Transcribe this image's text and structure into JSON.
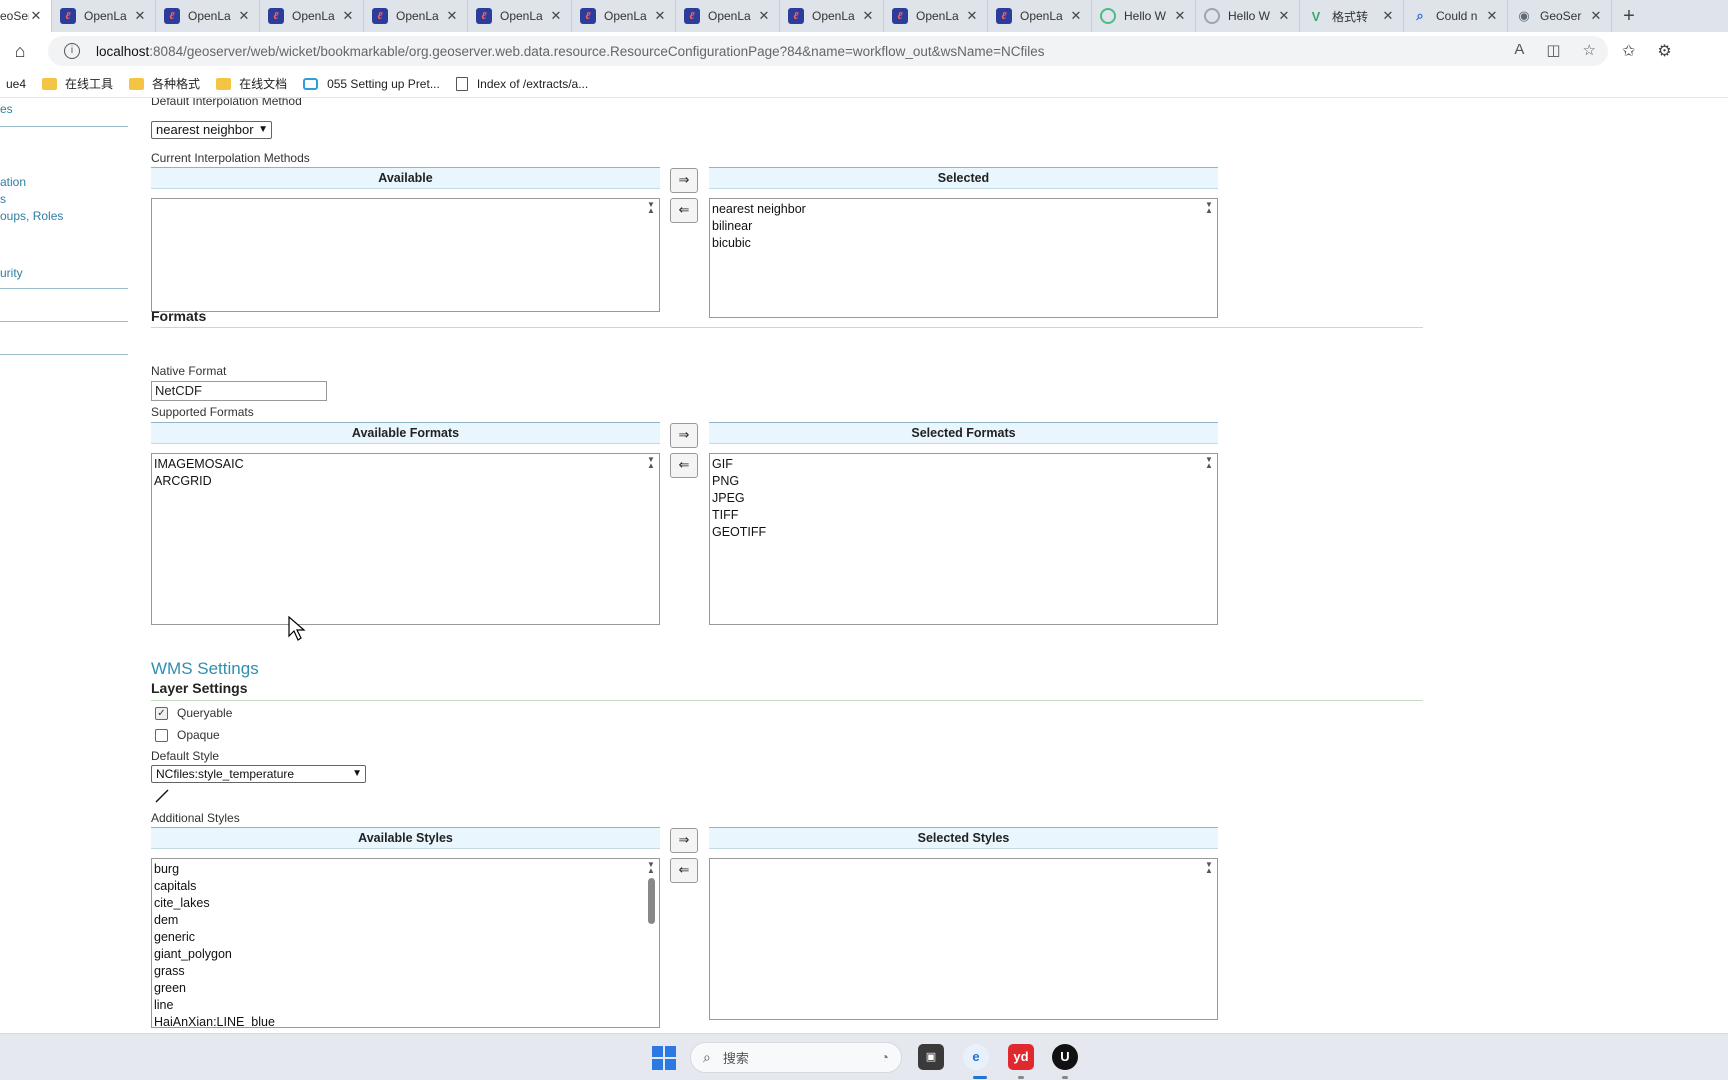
{
  "browser": {
    "tabs": [
      {
        "label": "eoSer",
        "icon": "geoserver-icon",
        "active": true
      },
      {
        "label": "OpenLa",
        "icon": "openlayers-icon"
      },
      {
        "label": "OpenLa",
        "icon": "openlayers-icon"
      },
      {
        "label": "OpenLa",
        "icon": "openlayers-icon"
      },
      {
        "label": "OpenLa",
        "icon": "openlayers-icon"
      },
      {
        "label": "OpenLa",
        "icon": "openlayers-icon"
      },
      {
        "label": "OpenLa",
        "icon": "openlayers-icon"
      },
      {
        "label": "OpenLa",
        "icon": "openlayers-icon"
      },
      {
        "label": "OpenLa",
        "icon": "openlayers-icon"
      },
      {
        "label": "OpenLa",
        "icon": "openlayers-icon"
      },
      {
        "label": "OpenLa",
        "icon": "openlayers-icon"
      },
      {
        "label": "Hello W",
        "icon": "hello-icon"
      },
      {
        "label": "Hello W",
        "icon": "hello-icon"
      },
      {
        "label": "格式转",
        "icon": "vue-icon"
      },
      {
        "label": "Could n",
        "icon": "search-icon"
      },
      {
        "label": "GeoSer",
        "icon": "geoserver-icon"
      }
    ],
    "url_host": "localhost",
    "url_rest": ":8084/geoserver/web/wicket/bookmarkable/org.geoserver.web.data.resource.ResourceConfigurationPage?84&name=workflow_out&wsName=NCfiles",
    "bookmarks": [
      {
        "label": "ue4",
        "icon": "none"
      },
      {
        "label": "在线工具",
        "icon": "folder-icon"
      },
      {
        "label": "各种格式",
        "icon": "folder-icon"
      },
      {
        "label": "在线文档",
        "icon": "folder-icon"
      },
      {
        "label": "055 Setting up Pret...",
        "icon": "tv-icon"
      },
      {
        "label": "Index of /extracts/a...",
        "icon": "page-icon"
      }
    ]
  },
  "sidebar": {
    "links": [
      "es",
      "ation",
      "s",
      "oups, Roles",
      "urity"
    ]
  },
  "interpolation": {
    "default_label": "Default Interpolation Method",
    "default_value": "nearest neighbor",
    "current_label": "Current Interpolation Methods",
    "available_header": "Available",
    "selected_header": "Selected",
    "available": [],
    "selected": [
      "nearest neighbor",
      "bilinear",
      "bicubic"
    ]
  },
  "formats": {
    "title": "Formats",
    "native_label": "Native Format",
    "native_value": "NetCDF",
    "supported_label": "Supported Formats",
    "available_header": "Available Formats",
    "selected_header": "Selected Formats",
    "available": [
      "IMAGEMOSAIC",
      "ARCGRID"
    ],
    "selected": [
      "GIF",
      "PNG",
      "JPEG",
      "TIFF",
      "GEOTIFF"
    ]
  },
  "wms": {
    "title": "WMS Settings",
    "layer_settings": "Layer Settings",
    "queryable_label": "Queryable",
    "queryable": true,
    "opaque_label": "Opaque",
    "opaque": false,
    "default_style_label": "Default Style",
    "default_style": "NCfiles:style_temperature",
    "additional_styles_label": "Additional Styles",
    "available_header": "Available Styles",
    "selected_header": "Selected Styles",
    "available": [
      "burg",
      "capitals",
      "cite_lakes",
      "dem",
      "generic",
      "giant_polygon",
      "grass",
      "green",
      "line",
      "HaiAnXian:LINE_blue"
    ],
    "selected": []
  },
  "buttons": {
    "add": "⇒",
    "remove": "⇐"
  },
  "taskbar": {
    "search_placeholder": "搜索"
  }
}
